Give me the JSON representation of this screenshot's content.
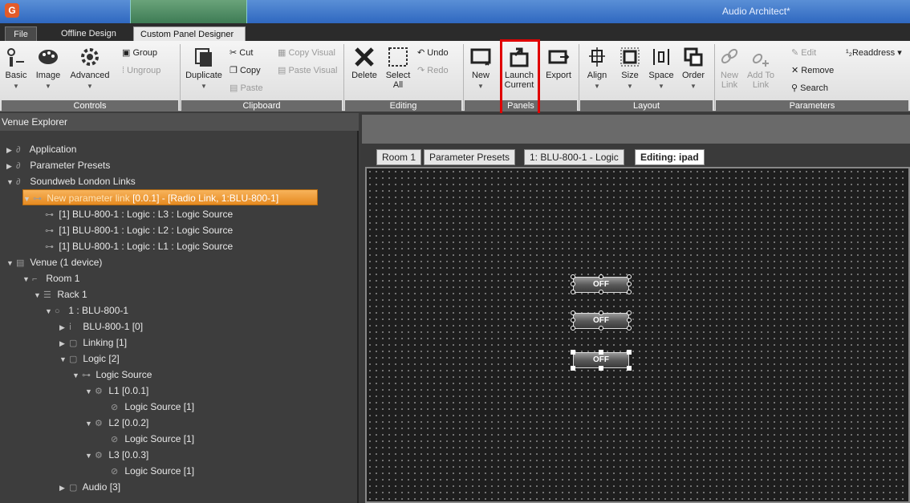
{
  "app": {
    "title": "Audio Architect*",
    "icon_letter": "G"
  },
  "menu_tabs": [
    "File",
    "Offline Design",
    "Custom Panel Designer"
  ],
  "ribbon": {
    "controls": {
      "label": "Controls",
      "basic": "Basic",
      "image": "Image",
      "advanced": "Advanced",
      "group": "Group",
      "ungroup": "Ungroup"
    },
    "clipboard": {
      "label": "Clipboard",
      "duplicate": "Duplicate",
      "cut": "Cut",
      "copy": "Copy",
      "paste": "Paste",
      "copy_visual": "Copy Visual",
      "paste_visual": "Paste Visual"
    },
    "editing": {
      "label": "Editing",
      "delete": "Delete",
      "select": "Select",
      "all": "All",
      "undo": "Undo",
      "redo": "Redo"
    },
    "panels": {
      "label": "Panels",
      "new": "New",
      "launch": "Launch",
      "current": "Current",
      "export": "Export"
    },
    "layout": {
      "label": "Layout",
      "align": "Align",
      "size": "Size",
      "space": "Space",
      "order": "Order"
    },
    "parameters": {
      "label": "Parameters",
      "new_link": "New",
      "new_link2": "Link",
      "add_to": "Add To",
      "add_to2": "Link",
      "edit": "Edit",
      "remove": "Remove",
      "search": "Search",
      "readdress": "Readdress"
    }
  },
  "explorer": {
    "title": "Venue Explorer",
    "nodes": [
      "Application",
      "Parameter Presets",
      "Soundweb London Links",
      "New parameter link",
      "[0.0.1]  -  [Radio Link, 1:BLU-800-1]",
      "[1] BLU-800-1 : Logic : L3 : Logic Source",
      "[1] BLU-800-1 : Logic : L2 : Logic Source",
      "[1] BLU-800-1 : Logic : L1 : Logic Source",
      "Venue (1 device)",
      "Room 1",
      "Rack 1",
      "1 : BLU-800-1",
      "BLU-800-1 [0]",
      "Linking [1]",
      "Logic [2]",
      "Logic Source",
      "L1 [0.0.1]",
      "Logic Source [1]",
      "L2 [0.0.2]",
      "Logic Source [1]",
      "L3 [0.0.3]",
      "Logic Source [1]",
      "Audio [3]"
    ]
  },
  "doc_tabs": [
    "Room 1",
    "Parameter Presets",
    "1: BLU-800-1 - Logic",
    "Editing: ipad"
  ],
  "canvas": {
    "buttons": [
      "OFF",
      "OFF",
      "OFF"
    ]
  }
}
